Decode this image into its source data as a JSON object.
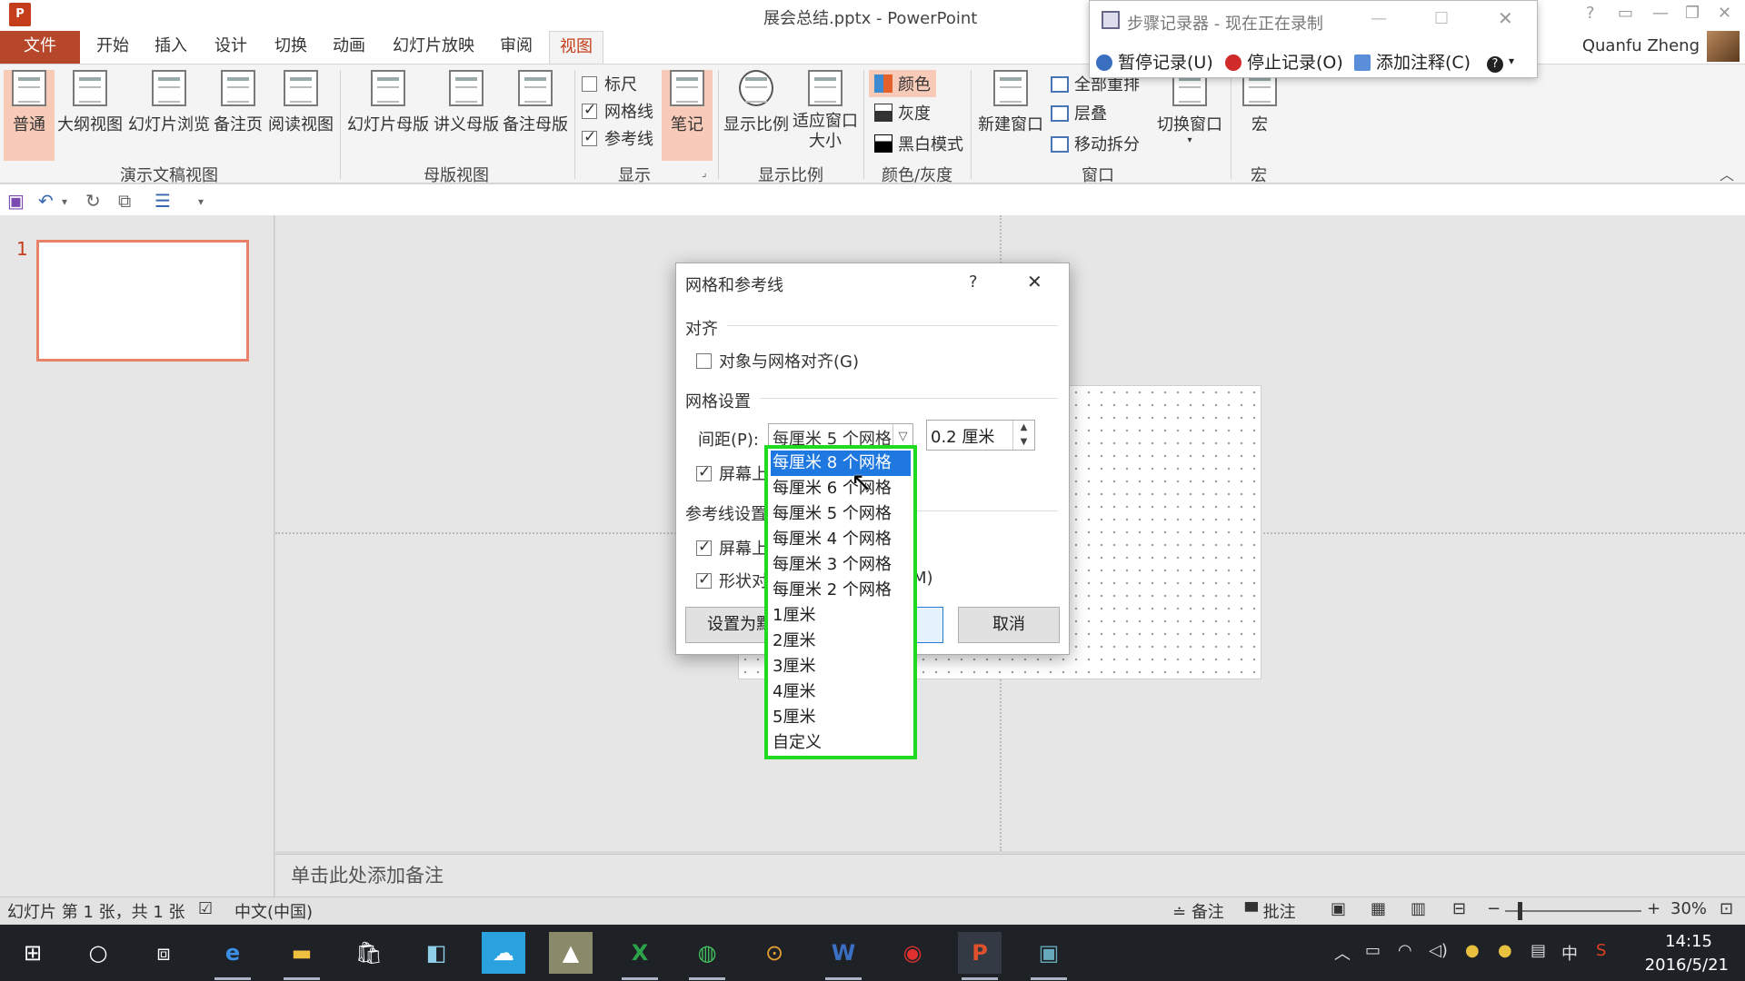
{
  "window": {
    "title": "展会总结.pptx - PowerPoint",
    "app_logo": "P",
    "user": "Quanfu Zheng"
  },
  "tabs": [
    {
      "label": "文件"
    },
    {
      "label": "开始"
    },
    {
      "label": "插入"
    },
    {
      "label": "设计"
    },
    {
      "label": "切换"
    },
    {
      "label": "动画"
    },
    {
      "label": "幻灯片放映"
    },
    {
      "label": "审阅"
    },
    {
      "label": "视图"
    }
  ],
  "ribbon": {
    "presentation_views": {
      "label": "演示文稿视图",
      "buttons": [
        "普通",
        "大纲视图",
        "幻灯片浏览",
        "备注页",
        "阅读视图"
      ]
    },
    "master_views": {
      "label": "母版视图",
      "buttons": [
        "幻灯片母版",
        "讲义母版",
        "备注母版"
      ]
    },
    "show": {
      "label": "显示",
      "ruler": "标尺",
      "gridlines": "网格线",
      "guides": "参考线",
      "notes": "笔记"
    },
    "zoom": {
      "label": "显示比例",
      "zoom": "显示比例",
      "fit": "适应窗口大小"
    },
    "color": {
      "label": "颜色/灰度",
      "color": "颜色",
      "gray": "灰度",
      "bw": "黑白模式"
    },
    "window": {
      "label": "窗口",
      "new": "新建窗口",
      "arrange": "全部重排",
      "cascade": "层叠",
      "split": "移动拆分",
      "switch": "切换窗口"
    },
    "macros": {
      "label": "宏",
      "macro": "宏"
    }
  },
  "recorder": {
    "title": "步骤记录器 - 现在正在录制",
    "pause": "暂停记录(U)",
    "stop": "停止记录(O)",
    "comment": "添加注释(C)"
  },
  "slides": {
    "num": "1",
    "notes_placeholder": "单击此处添加备注"
  },
  "dialog": {
    "title": "网格和参考线",
    "help": "?",
    "align_section": "对齐",
    "snap_to_grid": "对象与网格对齐(G)",
    "grid_section": "网格设置",
    "spacing_label": "间距(P):",
    "spacing_value": "每厘米 5 个网格",
    "spacing_number": "0.2 厘米",
    "show_grid_partial": "屏幕上",
    "guide_section": "参考线设置",
    "show_guides_partial": "屏幕上",
    "smart_guides_partial": "形状对",
    "smart_guides_tail": "M)",
    "set_default": "设置为默",
    "cancel": "取消"
  },
  "dropdown": {
    "items": [
      "每厘米 8 个网格",
      "每厘米 6 个网格",
      "每厘米 5 个网格",
      "每厘米 4 个网格",
      "每厘米 3 个网格",
      "每厘米 2 个网格",
      "1厘米",
      "2厘米",
      "3厘米",
      "4厘米",
      "5厘米",
      "自定义"
    ],
    "selected_index": 0,
    "highlight_color": "#1fdb1f"
  },
  "statusbar": {
    "slide_info": "幻灯片 第 1 张，共 1 张",
    "language": "中文(中国)",
    "notes": "备注",
    "comments": "批注",
    "zoom": "30%"
  },
  "taskbar": {
    "time": "14:15",
    "date": "2016/5/21",
    "ime": "中"
  }
}
